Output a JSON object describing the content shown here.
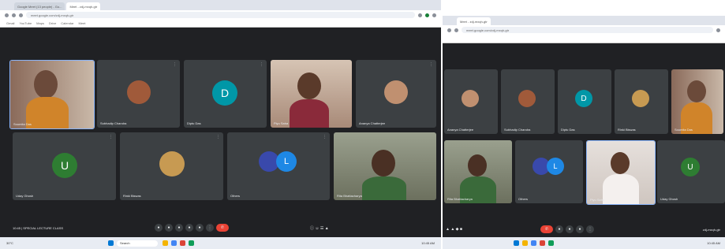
{
  "left": {
    "tabs": [
      "Google Meet (13 people) - Go...",
      "Meet - zdj-mxqh-gtr"
    ],
    "url": "meet.google.com/zdj-mxqh-gtr",
    "bookmarks": [
      "Gmail",
      "YouTube",
      "Maps",
      "Drive",
      "Calendar",
      "Meet"
    ],
    "participants": [
      {
        "name": "Soumita Das",
        "kind": "video"
      },
      {
        "name": "Subhadip Chandra",
        "kind": "avatar-photo"
      },
      {
        "name": "Diptu Das",
        "kind": "avatar",
        "initial": "D",
        "color": "#0097a7"
      },
      {
        "name": "Piyu Saha",
        "kind": "video"
      },
      {
        "name": "Ananya Chatterjee",
        "kind": "avatar-photo"
      },
      {
        "name": "Uday Ghosh",
        "kind": "avatar",
        "initial": "U",
        "color": "#2e7d32"
      },
      {
        "name": "Rinki Biswas",
        "kind": "avatar-photo"
      },
      {
        "name": "Others",
        "kind": "group",
        "initial": "L",
        "color": "#1e88e5"
      },
      {
        "name": "Rita Bhattacharya",
        "kind": "video"
      }
    ],
    "meeting_info": "10:45 | SPECIAL LECTURE CLASS",
    "taskbar_search": "Search",
    "weather": "30°C",
    "tray_time": "10:45 AM"
  },
  "right": {
    "tabs": [
      "Meet - zdj-mxqh-gtr"
    ],
    "url": "meet.google.com/zdj-mxqh-gtr",
    "participants": [
      {
        "name": "Ananya Chatterjee",
        "kind": "avatar-photo"
      },
      {
        "name": "Subhadip Chandra",
        "kind": "avatar-photo"
      },
      {
        "name": "Diptu Das",
        "kind": "avatar",
        "initial": "D",
        "color": "#0097a7"
      },
      {
        "name": "Rinki Biswas",
        "kind": "avatar-photo"
      },
      {
        "name": "Soumita Das",
        "kind": "video"
      },
      {
        "name": "Rita Bhattacharya",
        "kind": "video"
      },
      {
        "name": "Others",
        "kind": "group",
        "initial": "L",
        "color": "#1e88e5"
      },
      {
        "name": "Piyu Saha",
        "kind": "video"
      },
      {
        "name": "Uday Ghosh",
        "kind": "avatar",
        "initial": "U",
        "color": "#2e7d32"
      }
    ],
    "meeting_info": "zdj-mxqh-gtr",
    "tray_time": "10:45 AM"
  }
}
